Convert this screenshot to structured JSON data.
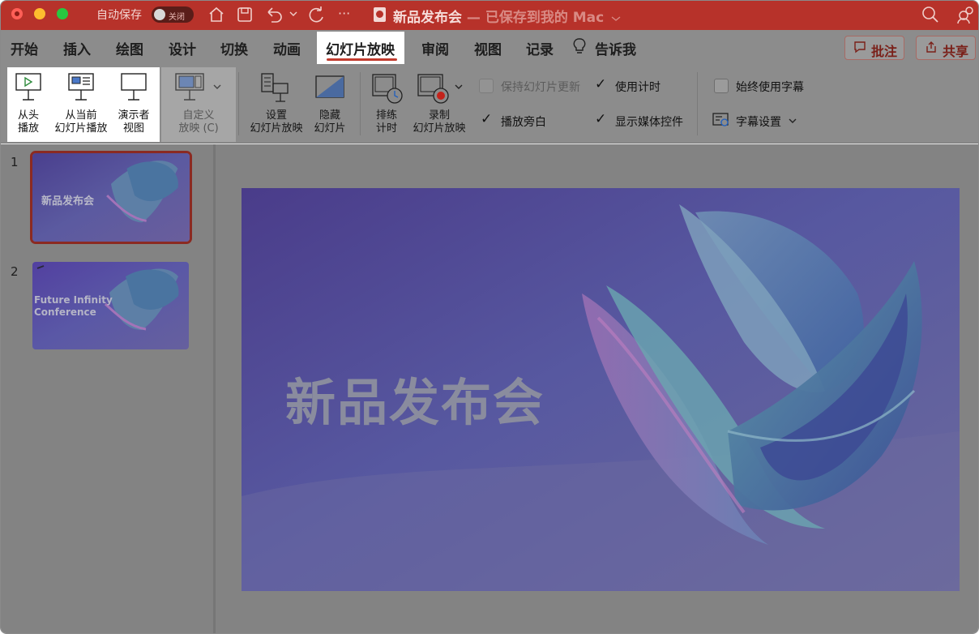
{
  "titlebar": {
    "autosave_label": "自动保存",
    "autosave_toggle": "关闭",
    "doc_title": "新品发布会",
    "doc_subtitle": " — 已保存到我的 Mac",
    "more": "···"
  },
  "tabs": {
    "items": [
      "开始",
      "插入",
      "绘图",
      "设计",
      "切换",
      "动画"
    ],
    "active": "幻灯片放映",
    "after": [
      "审阅",
      "视图",
      "记录"
    ],
    "tell_me": "告诉我",
    "comment": "批注",
    "share": "共享"
  },
  "ribbon": {
    "from_start": [
      "从头",
      "播放"
    ],
    "from_current": [
      "从当前",
      "幻灯片播放"
    ],
    "presenter": [
      "演示者",
      "视图"
    ],
    "custom": [
      "自定义",
      "放映 (C)"
    ],
    "setup": [
      "设置",
      "幻灯片放映"
    ],
    "hide": [
      "隐藏",
      "幻灯片"
    ],
    "rehearse": [
      "排练",
      "计时"
    ],
    "record": [
      "录制",
      "幻灯片放映"
    ],
    "keep_updated": "保持幻灯片更新",
    "use_timings": "使用计时",
    "play_narration": "播放旁白",
    "show_media_controls": "显示媒体控件",
    "always_subtitles": "始终使用字幕",
    "subtitle_settings": "字幕设置"
  },
  "thumbs": {
    "slide1_num": "1",
    "slide1_title": "新品发布会",
    "slide2_num": "2",
    "slide2_title_line1": "Future Infinity",
    "slide2_title_line2": "Conference"
  },
  "slide": {
    "title": "新品发布会"
  },
  "colors": {
    "title_bar": "#b7322a",
    "accent": "#c23b2e",
    "dim_overlay": "#8c8c8c"
  }
}
